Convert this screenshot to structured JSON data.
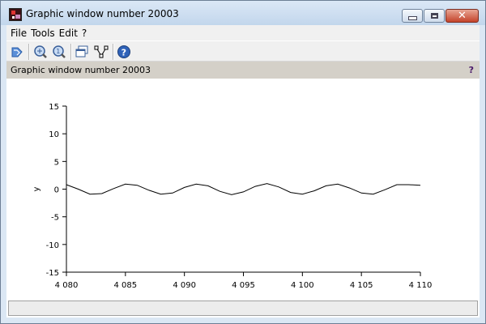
{
  "window": {
    "title": "Graphic window number 20003"
  },
  "menu": {
    "items": [
      {
        "label": "File"
      },
      {
        "label": "Tools"
      },
      {
        "label": "Edit"
      },
      {
        "label": "?"
      }
    ]
  },
  "toolbar": {
    "buttons": [
      {
        "icon": "rotate-icon"
      },
      {
        "icon": "zoom-in-icon"
      },
      {
        "icon": "zoom-reset-icon"
      },
      {
        "icon": "new-window-icon"
      },
      {
        "icon": "datatip-icon"
      },
      {
        "icon": "help-icon"
      }
    ]
  },
  "infobar": {
    "text": "Graphic window number 20003",
    "help": "?"
  },
  "status": {
    "text": ""
  },
  "chart_data": {
    "type": "line",
    "title": "",
    "xlabel": "",
    "ylabel": "y",
    "xlim": [
      4080,
      4110
    ],
    "ylim": [
      -15,
      15
    ],
    "x_ticks": [
      "4 080",
      "4 085",
      "4 090",
      "4 095",
      "4 100",
      "4 105",
      "4 110"
    ],
    "y_ticks": [
      "15",
      "10",
      "5",
      "0",
      "-5",
      "-10",
      "-15"
    ],
    "series": [
      {
        "color": "#000000",
        "x": [
          4080,
          4081,
          4082,
          4083,
          4084,
          4085,
          4086,
          4087,
          4088,
          4089,
          4090,
          4091,
          4092,
          4093,
          4094,
          4095,
          4096,
          4097,
          4098,
          4099,
          4100,
          4101,
          4102,
          4103,
          4104,
          4105,
          4106,
          4107,
          4108,
          4109,
          4110
        ],
        "y": [
          0.8,
          0.0,
          -0.9,
          -0.8,
          0.1,
          0.9,
          0.7,
          -0.2,
          -0.9,
          -0.7,
          0.3,
          0.9,
          0.6,
          -0.4,
          -1.0,
          -0.5,
          0.5,
          1.0,
          0.4,
          -0.6,
          -0.9,
          -0.3,
          0.6,
          0.9,
          0.2,
          -0.7,
          -0.9,
          -0.1,
          0.8,
          0.8,
          0.7
        ]
      }
    ]
  }
}
